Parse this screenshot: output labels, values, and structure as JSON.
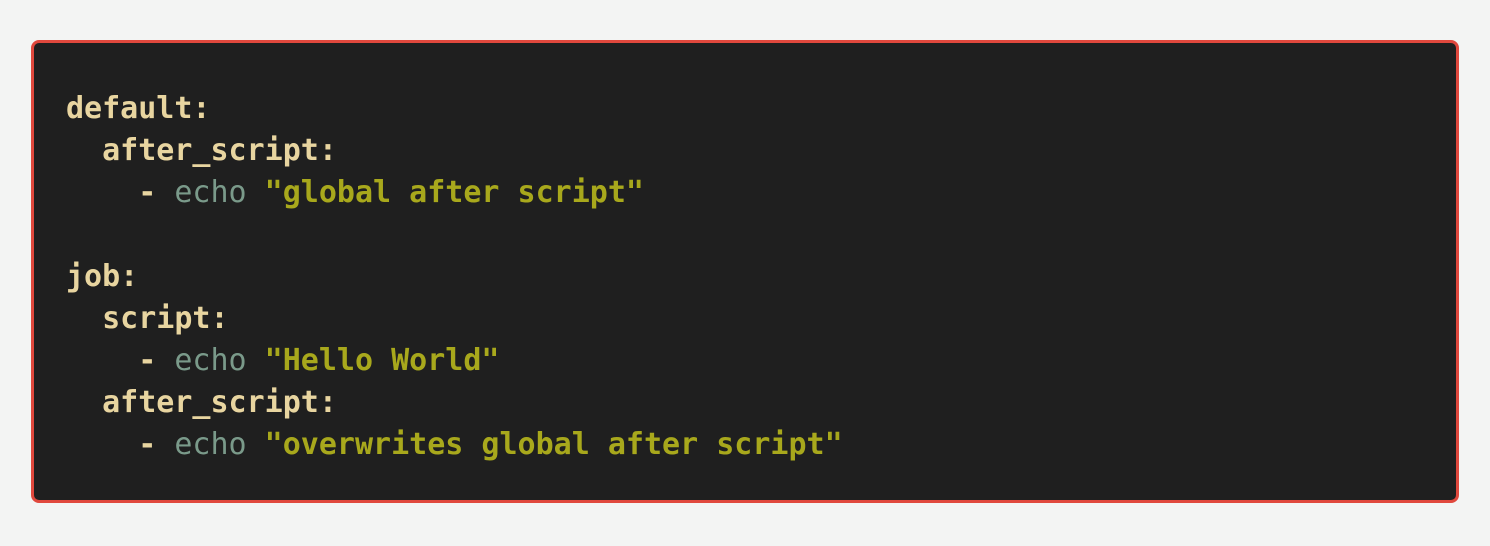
{
  "colors": {
    "page_background": "#f3f4f3",
    "block_background": "#1f1f1f",
    "block_border": "#e0483d",
    "key": "#e8d5a0",
    "command": "#7a9a8a",
    "string": "#a8a81c"
  },
  "code": {
    "lines": [
      {
        "indent": "",
        "key": "default:"
      },
      {
        "indent": "  ",
        "key": "after_script:"
      },
      {
        "indent": "    ",
        "dash": "- ",
        "cmd": "echo",
        "str": " \"global after script\""
      },
      {
        "indent": "",
        "key": ""
      },
      {
        "indent": "",
        "key": "job:"
      },
      {
        "indent": "  ",
        "key": "script:"
      },
      {
        "indent": "    ",
        "dash": "- ",
        "cmd": "echo",
        "str": " \"Hello World\""
      },
      {
        "indent": "  ",
        "key": "after_script:"
      },
      {
        "indent": "    ",
        "dash": "- ",
        "cmd": "echo",
        "str": " \"overwrites global after script\""
      }
    ]
  }
}
